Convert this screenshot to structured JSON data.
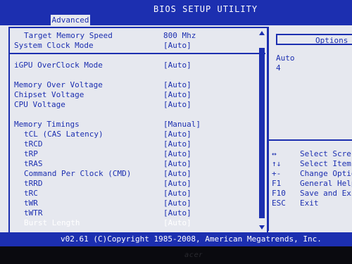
{
  "title": "BIOS SETUP UTILITY",
  "active_tab": "Advanced",
  "options_header": "Options",
  "options": [
    "Auto",
    "4"
  ],
  "settings": [
    {
      "label": "Target Memory Speed",
      "value": "800 Mhz",
      "style": "indent"
    },
    {
      "label": "System Clock Mode",
      "value": "[Auto]"
    },
    {
      "label": "iGPU OverClock Mode",
      "value": "[Auto]"
    },
    {
      "label": "Memory Over Voltage",
      "value": "[Auto]"
    },
    {
      "label": "Chipset Voltage",
      "value": "[Auto]"
    },
    {
      "label": "CPU Voltage",
      "value": "[Auto]"
    },
    {
      "label": "Memory Timings",
      "value": "[Manual]"
    },
    {
      "label": "tCL (CAS Latency)",
      "value": "[Auto]"
    },
    {
      "label": "tRCD",
      "value": "[Auto]"
    },
    {
      "label": "tRP",
      "value": "[Auto]"
    },
    {
      "label": "tRAS",
      "value": "[Auto]"
    },
    {
      "label": "Command Per Clock (CMD)",
      "value": "[Auto]"
    },
    {
      "label": "tRRD",
      "value": "[Auto]"
    },
    {
      "label": "tRC",
      "value": "[Auto]"
    },
    {
      "label": "tWR",
      "value": "[Auto]"
    },
    {
      "label": "tWTR",
      "value": "[Auto]"
    },
    {
      "label": "Burst Length",
      "value": "[Auto]"
    }
  ],
  "help": [
    {
      "key": "↔",
      "desc": "Select Scre"
    },
    {
      "key": "↑↓",
      "desc": "Select Item"
    },
    {
      "key": "+-",
      "desc": "Change Optio"
    },
    {
      "key": "F1",
      "desc": "General Help"
    },
    {
      "key": "F10",
      "desc": "Save and Exi"
    },
    {
      "key": "ESC",
      "desc": "Exit"
    }
  ],
  "footer": "v02.61 (C)Copyright 1985-2008, American Megatrends, Inc.",
  "monitor_brand": "acer",
  "colors": {
    "bios_blue": "#1c2fb0",
    "panel_bg": "#e6e8ef",
    "highlight_text": "#ffffff"
  }
}
